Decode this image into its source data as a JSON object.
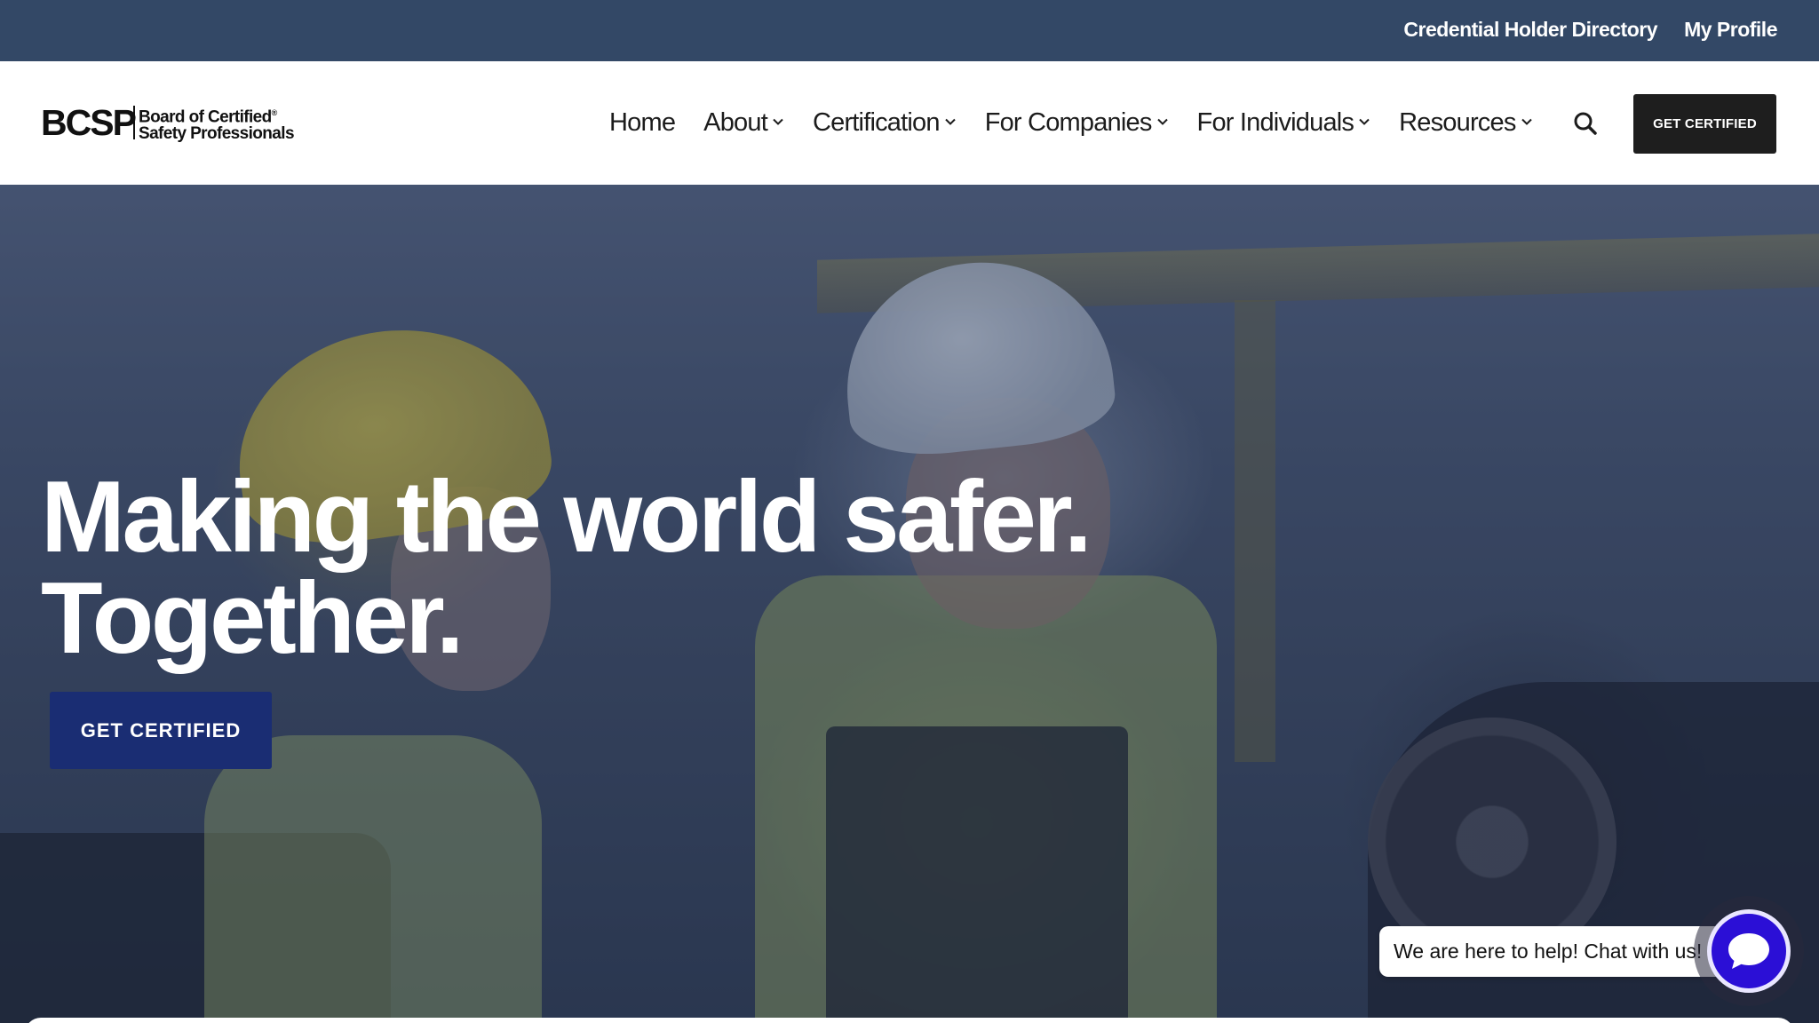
{
  "utility_bar": {
    "links": [
      "Credential Holder Directory",
      "My Profile"
    ]
  },
  "header": {
    "logo": {
      "mark": "BCSP",
      "line1": "Board of Certified",
      "line2": "Safety Professionals",
      "registered": "®"
    },
    "nav": [
      {
        "label": "Home",
        "has_dropdown": false
      },
      {
        "label": "About",
        "has_dropdown": true
      },
      {
        "label": "Certification",
        "has_dropdown": true
      },
      {
        "label": "For Companies",
        "has_dropdown": true
      },
      {
        "label": "For Individuals",
        "has_dropdown": true
      },
      {
        "label": "Resources",
        "has_dropdown": true
      }
    ],
    "search_icon": "search-icon",
    "cta_label": "GET CERTIFIED"
  },
  "hero": {
    "title_line1": "Making the world safer.",
    "title_line2": "Together.",
    "cta_label": "GET CERTIFIED",
    "cta_color": "#1a2d73"
  },
  "chat": {
    "prompt": "We are here to help! Chat with us!",
    "icon": "chat-bubble-icon",
    "accent": "#2b0fd6"
  },
  "colors": {
    "utility_bar": "#334866",
    "header_cta": "#1e1e1e"
  }
}
